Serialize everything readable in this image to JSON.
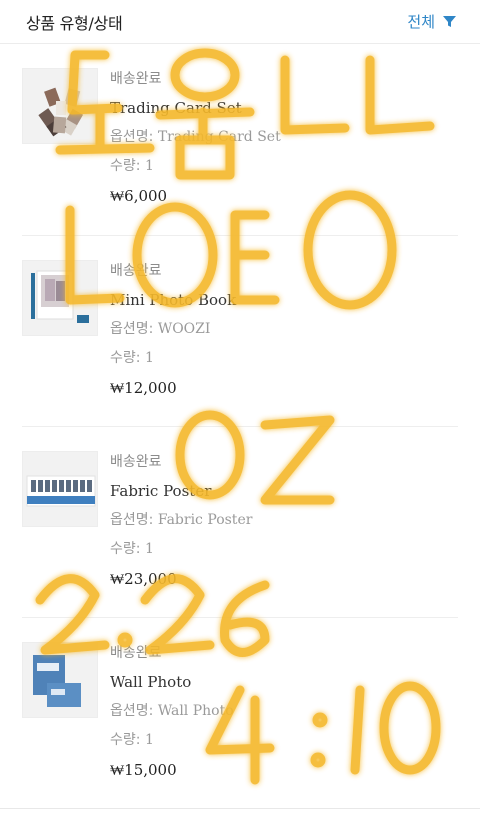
{
  "header": {
    "title": "상품 유형/상태",
    "filter_label": "전체",
    "filter_icon": "filter-icon",
    "accent_color": "#2f86c7"
  },
  "items": [
    {
      "status": "배송완료",
      "name": "Trading Card Set",
      "option_label": "옵션명:",
      "option_value": "Trading Card Set",
      "qty_label": "수량:",
      "qty_value": "1",
      "price": "₩6,000",
      "thumb_icon": "trading-card-photo"
    },
    {
      "status": "배송완료",
      "name": "Mini Photo Book",
      "option_label": "옵션명:",
      "option_value": "WOOZI",
      "qty_label": "수량:",
      "qty_value": "1",
      "price": "₩12,000",
      "thumb_icon": "photo-book-photo"
    },
    {
      "status": "배송완료",
      "name": "Fabric Poster",
      "option_label": "옵션명:",
      "option_value": "Fabric Poster",
      "qty_label": "수량:",
      "qty_value": "1",
      "price": "₩23,000",
      "thumb_icon": "fabric-poster-photo"
    },
    {
      "status": "배송완료",
      "name": "Wall Photo",
      "option_label": "옵션명:",
      "option_value": "Wall Photo",
      "qty_label": "수량:",
      "qty_value": "1",
      "price": "₩15,000",
      "thumb_icon": "wall-photo-photo"
    }
  ],
  "handwriting": {
    "text": "도움ㄴㄴ LOTEO OZ 2.26 4:10",
    "color": "#f5b82a"
  }
}
